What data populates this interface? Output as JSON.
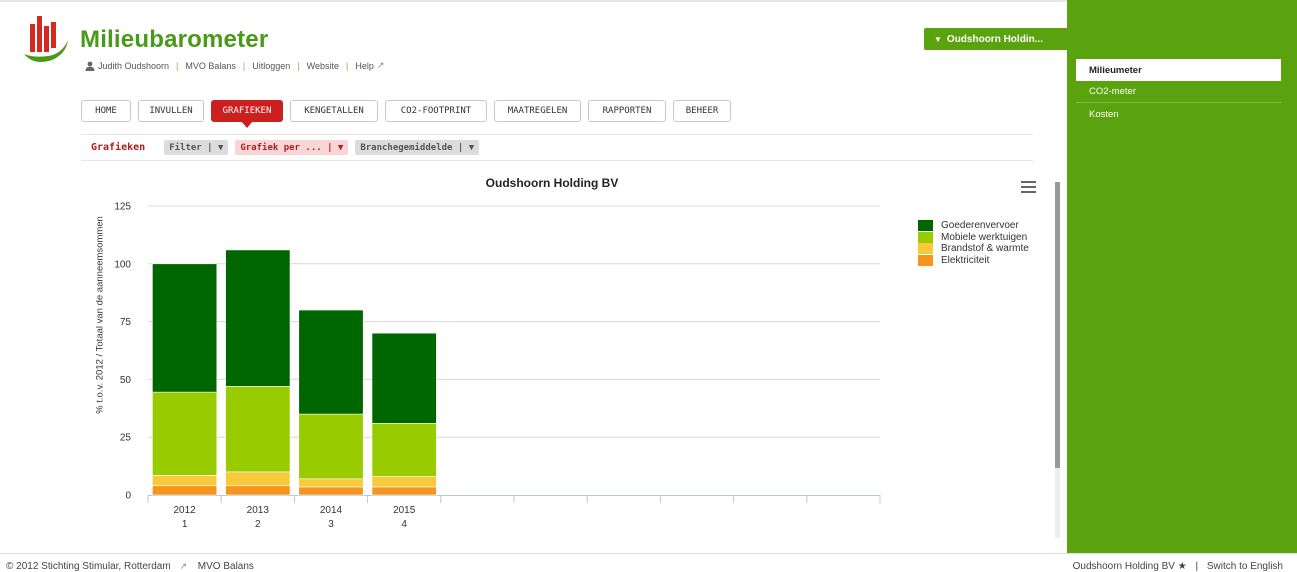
{
  "header": {
    "title": "Milieubarometer",
    "user_name": "Judith Oudshoorn",
    "links": [
      "MVO Balans",
      "Uitloggen",
      "Website",
      "Help"
    ]
  },
  "company_selector": {
    "label": "Oudshoorn Holdin..."
  },
  "nav": {
    "tabs": [
      "HOME",
      "INVULLEN",
      "GRAFIEKEN",
      "KENGETALLEN",
      "CO2-FOOTPRINT",
      "MAATREGELEN",
      "RAPPORTEN",
      "BEHEER"
    ],
    "active": "GRAFIEKEN"
  },
  "subbar": {
    "label": "Grafieken",
    "filters": [
      "Filter | ▼",
      "Grafiek per ... | ▼",
      "Branchegemiddelde | ▼"
    ]
  },
  "sidebar": {
    "items": [
      "Milieumeter",
      "CO2-meter",
      "Kosten"
    ],
    "active": "Milieumeter"
  },
  "footer": {
    "copyright": "© 2012 Stichting Stimular, Rotterdam",
    "mvo_link": "MVO Balans",
    "company": "Oudshoorn Holding BV ★",
    "language_link": "Switch to English"
  },
  "chart_data": {
    "type": "bar",
    "stacked": true,
    "title": "Oudshoorn Holding BV",
    "ylabel": "% t.o.v. 2012 / Totaal van de aanneemsommen",
    "xlabel": "",
    "ylim": [
      0,
      125
    ],
    "yticks": [
      0,
      25,
      50,
      75,
      100,
      125
    ],
    "categories": [
      "2012",
      "2013",
      "2014",
      "2015"
    ],
    "category_sublabels": [
      "1",
      "2",
      "3",
      "4"
    ],
    "empty_slots": 6,
    "legend_position": "right",
    "grid": true,
    "series": [
      {
        "name": "Elektriciteit",
        "color": "#f7941d",
        "values": [
          4,
          4,
          3.5,
          3.5
        ]
      },
      {
        "name": "Brandstof & warmte",
        "color": "#f9c93c",
        "values": [
          4.5,
          6,
          3.5,
          4.5
        ]
      },
      {
        "name": "Mobiele werktuigen",
        "color": "#99cc00",
        "values": [
          36,
          37,
          28,
          23
        ]
      },
      {
        "name": "Goederenvervoer",
        "color": "#006600",
        "values": [
          55.5,
          59,
          45,
          39
        ]
      }
    ],
    "legend_order": [
      "Goederenvervoer",
      "Mobiele werktuigen",
      "Brandstof & warmte",
      "Elektriciteit"
    ]
  },
  "colors": {
    "brand_green": "#5aa20e",
    "title_green": "#4a9a1a",
    "active_red": "#cc1f1f"
  }
}
